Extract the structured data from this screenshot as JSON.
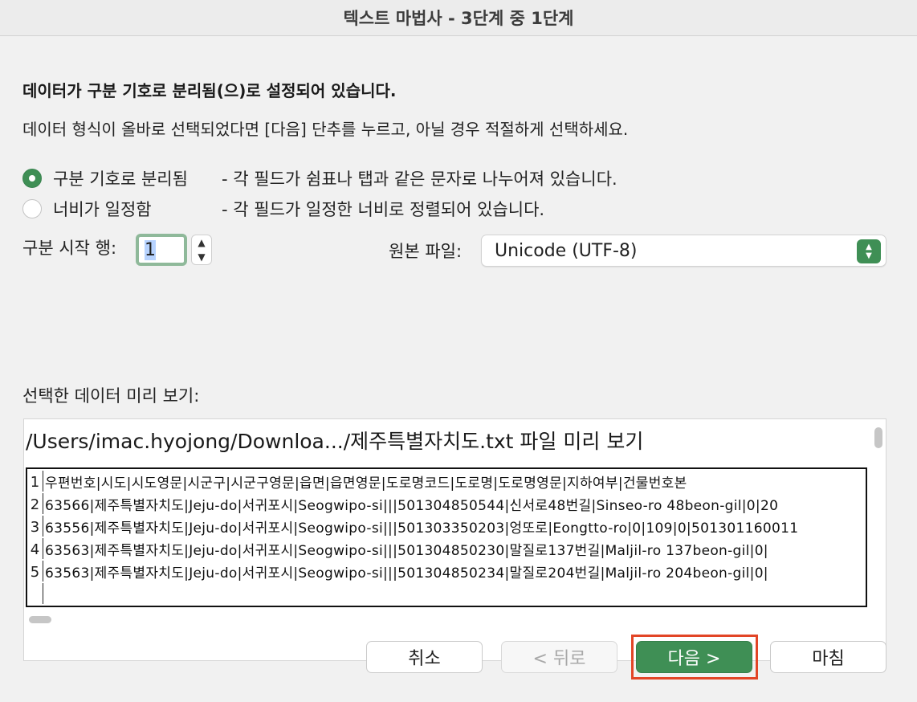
{
  "window": {
    "title": "텍스트 마법사 - 3단계 중 1단계"
  },
  "intro": {
    "heading": "데이터가 구분 기호로 분리됨(으)로 설정되어 있습니다.",
    "subheading": "데이터 형식이 올바로 선택되었다면 [다음] 단추를 누르고, 아닐 경우 적절하게 선택하세요."
  },
  "options": [
    {
      "label": "구분 기호로 분리됨",
      "desc": "- 각 필드가 쉼표나 탭과 같은 문자로 나누어져 있습니다.",
      "selected": true
    },
    {
      "label": "너비가 일정함",
      "desc": "- 각 필드가 일정한 너비로 정렬되어 있습니다.",
      "selected": false
    }
  ],
  "start_row": {
    "label": "구분 시작 행:",
    "value": "1"
  },
  "origin": {
    "label": "원본 파일:",
    "value": "Unicode (UTF-8)"
  },
  "preview": {
    "label": "선택한 데이터 미리 보기:",
    "title": "/Users/imac.hyojong/Downloa.../제주특별자치도.txt 파일 미리 보기",
    "rows": [
      {
        "num": "1",
        "text": "우편번호|시도|시도영문|시군구|시군구영문|읍면|읍면영문|도로명코드|도로명|도로명영문|지하여부|건물번호본"
      },
      {
        "num": "2",
        "text": "63566|제주특별자치도|Jeju-do|서귀포시|Seogwipo-si|||501304850544|신서로48번길|Sinseo-ro 48beon-gil|0|20"
      },
      {
        "num": "3",
        "text": "63556|제주특별자치도|Jeju-do|서귀포시|Seogwipo-si|||501303350203|엉또로|Eongtto-ro|0|109|0|501301160011"
      },
      {
        "num": "4",
        "text": "63563|제주특별자치도|Jeju-do|서귀포시|Seogwipo-si|||501304850230|말질로137번길|Maljil-ro 137beon-gil|0|"
      },
      {
        "num": "5",
        "text": "63563|제주특별자치도|Jeju-do|서귀포시|Seogwipo-si|||501304850234|말질로204번길|Maljil-ro 204beon-gil|0|"
      },
      {
        "num": "",
        "text": ""
      }
    ]
  },
  "buttons": {
    "cancel": "취소",
    "back": "< 뒤로",
    "next": "다음 >",
    "finish": "마침"
  },
  "colors": {
    "accent": "#3f8f55",
    "highlight": "#e24526"
  }
}
